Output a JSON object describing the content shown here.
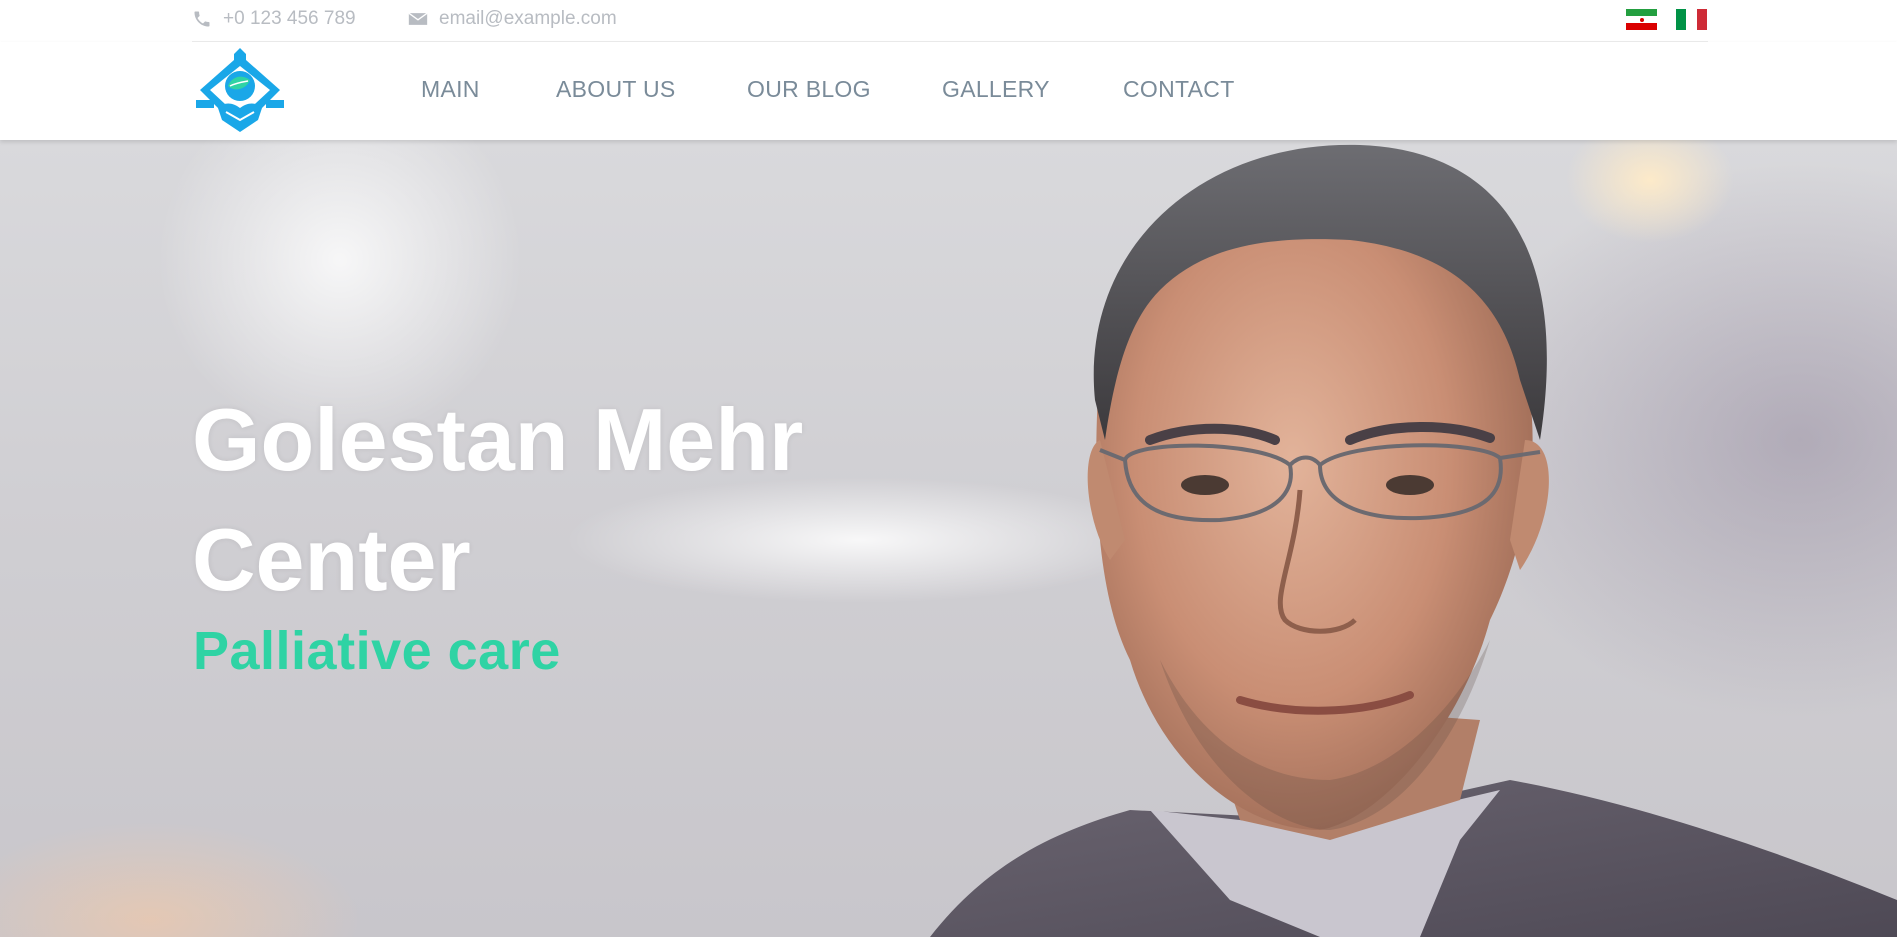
{
  "topbar": {
    "phone": "+0 123 456 789",
    "email": "email@example.com",
    "phone_icon": "phone-icon",
    "email_icon": "envelope-icon",
    "languages": [
      {
        "code": "fa",
        "flag": "iran-flag-icon"
      },
      {
        "code": "it",
        "flag": "italy-flag-icon"
      }
    ]
  },
  "nav": {
    "logo_icon": "golestan-mehr-logo-icon",
    "items": [
      {
        "label": "MAIN"
      },
      {
        "label": "ABOUT US"
      },
      {
        "label": "OUR BLOG"
      },
      {
        "label": "GALLERY"
      },
      {
        "label": "CONTACT"
      }
    ]
  },
  "hero": {
    "title_line1": "Golestan Mehr",
    "title_line2": "Center",
    "subtitle": "Palliative care"
  },
  "colors": {
    "accent_green": "#2fd3a4",
    "logo_blue": "#1aa7e8",
    "nav_text": "#7a8b99",
    "topbar_text": "#b8bcc2"
  }
}
